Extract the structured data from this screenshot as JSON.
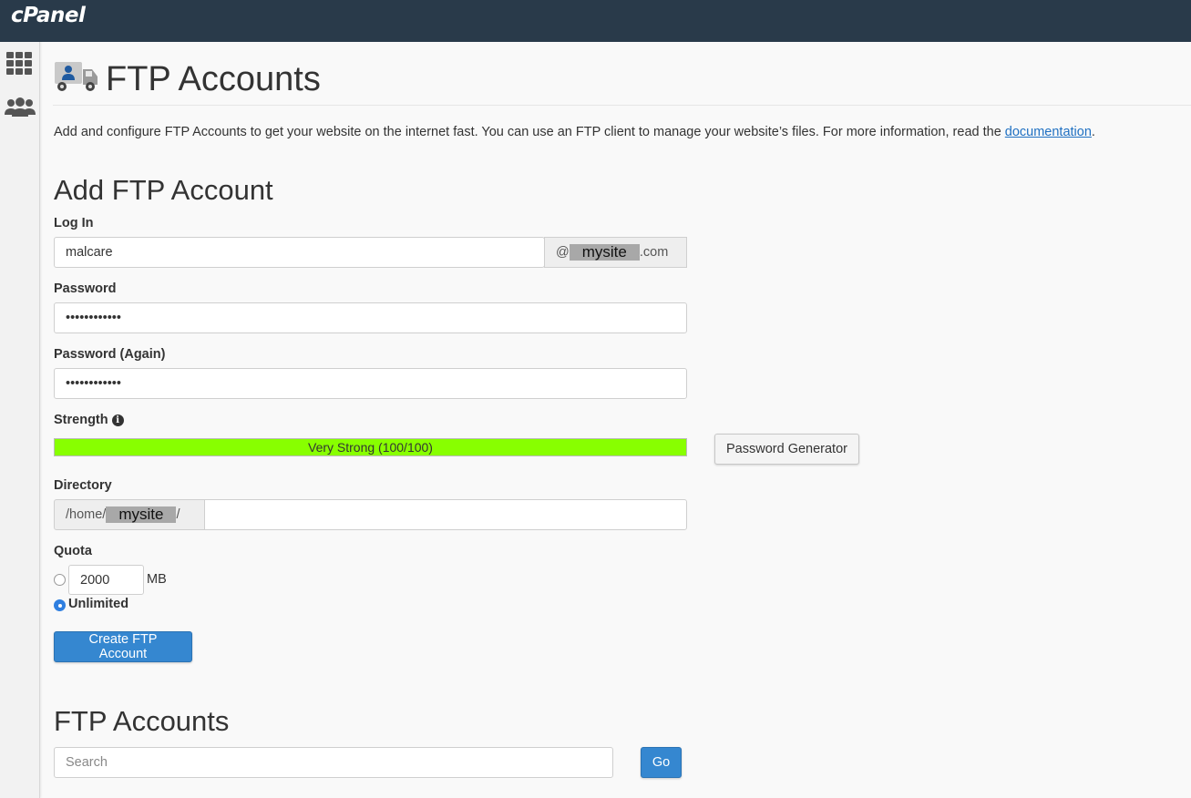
{
  "brand": "cPanel",
  "sidebar": {
    "items": [
      {
        "icon": "grid-icon"
      },
      {
        "icon": "users-icon"
      }
    ]
  },
  "page": {
    "title": "FTP Accounts",
    "icon": "ftp-truck-icon",
    "description_before": "Add and configure FTP Accounts to get your website on the internet fast. You can use an FTP client to manage your website’s files. For more information, read the ",
    "description_link": "documentation",
    "description_after": "."
  },
  "add_form": {
    "heading": "Add FTP Account",
    "login_label": "Log In",
    "login_value": "malcare",
    "domain_prefix": "@",
    "domain_redacted": "mysite",
    "domain_suffix": ".com",
    "password_label": "Password",
    "password_value": "••••••••••••",
    "password_again_label": "Password (Again)",
    "password_again_value": "••••••••••••",
    "strength_label": "Strength",
    "strength_text": "Very Strong (100/100)",
    "strength_percent": 100,
    "strength_color": "#88ff00",
    "password_generator_label": "Password Generator",
    "directory_label": "Directory",
    "directory_prefix": "/home/",
    "directory_redacted": "mysite",
    "directory_suffix": "/",
    "directory_value": "",
    "quota_label": "Quota",
    "quota_value": "2000",
    "quota_unit": "MB",
    "quota_unlimited_label": "Unlimited",
    "quota_selected": "unlimited",
    "submit_label": "Create FTP Account"
  },
  "list": {
    "heading": "FTP Accounts",
    "search_placeholder": "Search",
    "go_label": "Go"
  },
  "colors": {
    "topbar": "#293a4a",
    "primary": "#3587d0",
    "link": "#1f70c2"
  }
}
